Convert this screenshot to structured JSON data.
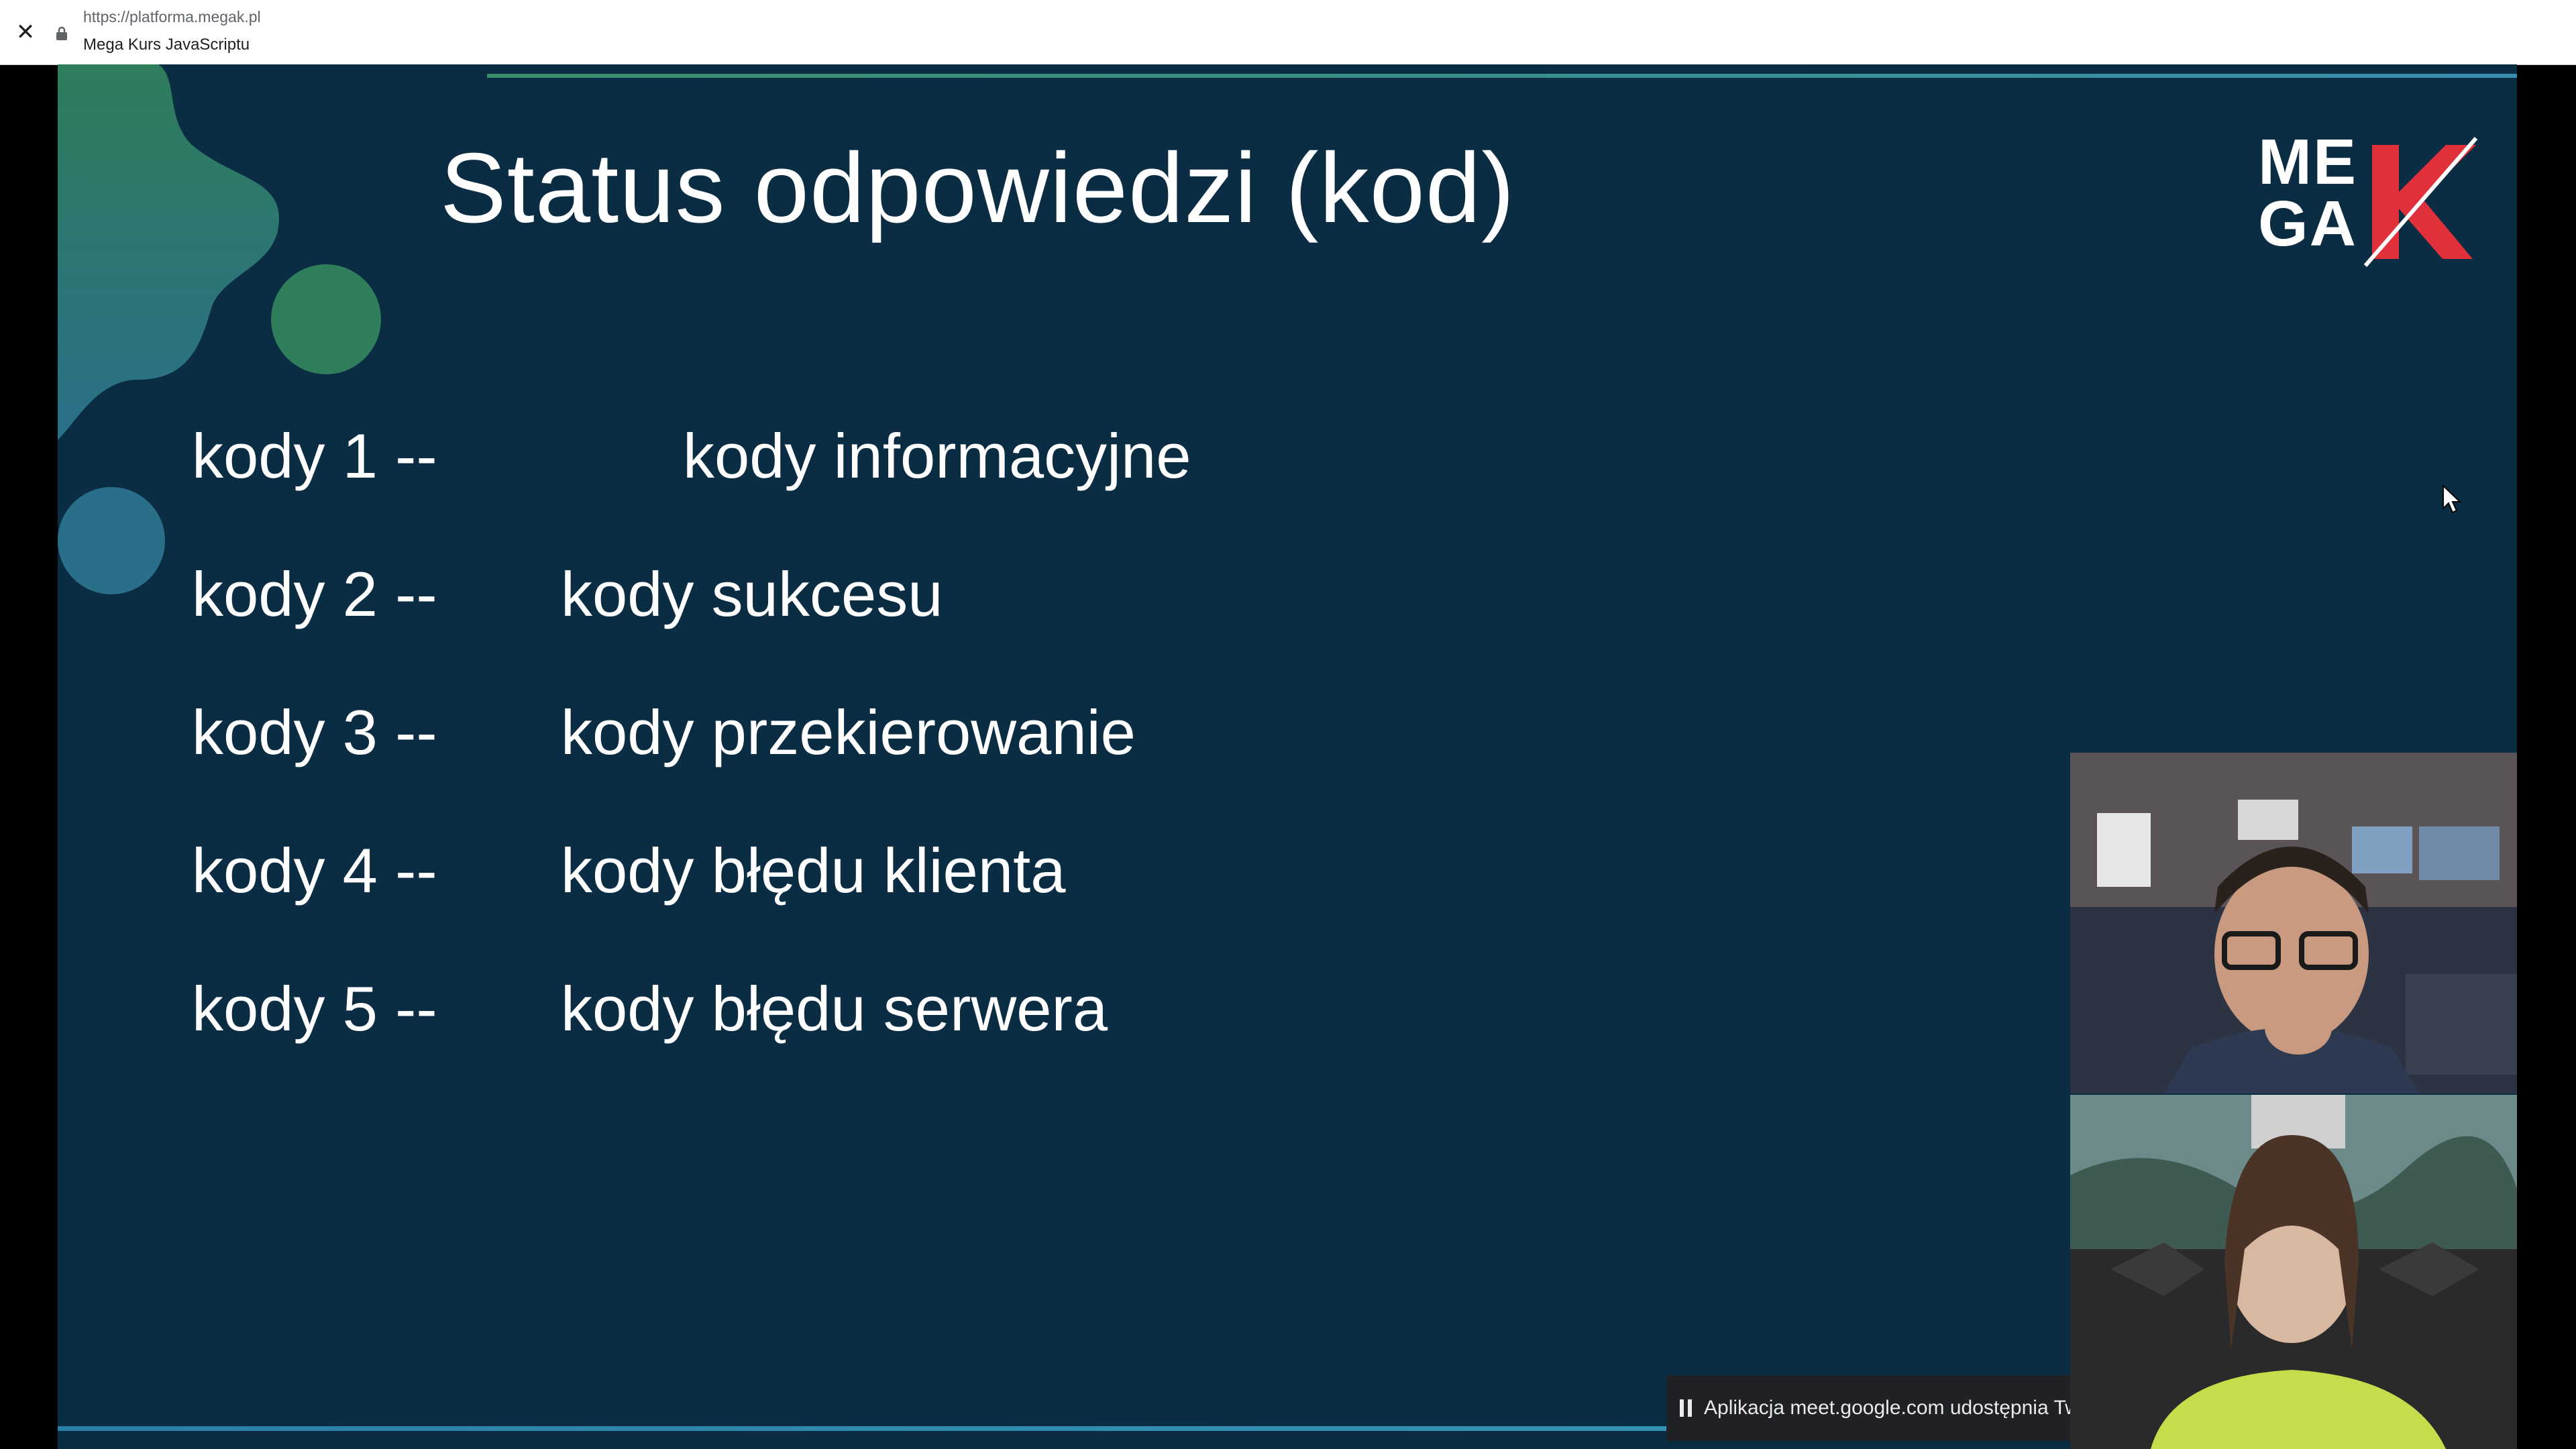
{
  "browser": {
    "url": "https://platforma.megak.pl",
    "page_title": "Mega Kurs JavaScriptu",
    "close_symbol": "✕"
  },
  "slide": {
    "title": "Status odpowiedzi (kod)",
    "logo": {
      "line1": "ME",
      "line2": "GA",
      "letter": "K",
      "accent": "#e0303a"
    },
    "codes": [
      {
        "code": "kody 1 --",
        "meaning": "kody informacyjne"
      },
      {
        "code": "kody 2 --",
        "meaning": "kody sukcesu"
      },
      {
        "code": "kody 3 --",
        "meaning": "kody przekierowanie"
      },
      {
        "code": "kody 4 --",
        "meaning": "kody błędu klienta"
      },
      {
        "code": "kody 5 --",
        "meaning": "kody błędu serwera"
      }
    ],
    "colors": {
      "background": "#0b2d44",
      "text": "#ffffff",
      "decor_green": "#2e7d5b",
      "decor_teal": "#2a6f8a"
    }
  },
  "share_bar": {
    "text": "Aplikacja meet.google.com udostępnia Two"
  }
}
